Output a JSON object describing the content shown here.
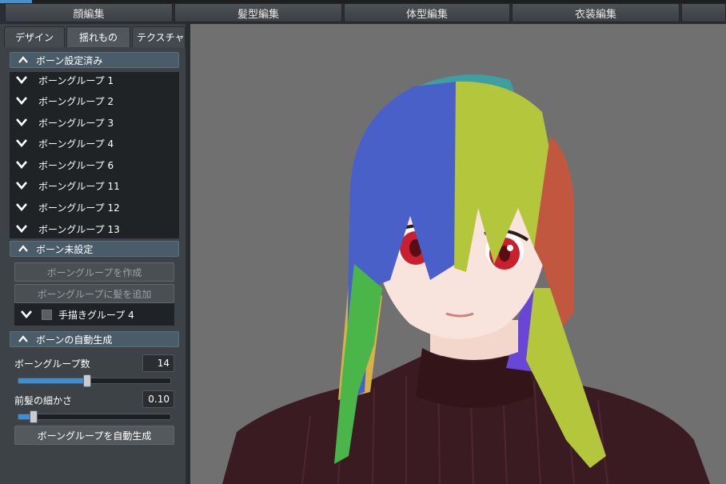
{
  "top_tabs": [
    "顔編集",
    "髪型編集",
    "体型編集",
    "衣装編集"
  ],
  "sub_tabs": [
    "デザイン",
    "揺れもの",
    "テクスチャ"
  ],
  "sections": {
    "bones_set": {
      "title": "ボーン設定済み",
      "groups": [
        "ボーングループ 1",
        "ボーングループ 2",
        "ボーングループ 3",
        "ボーングループ 4",
        "ボーングループ 6",
        "ボーングループ 11",
        "ボーングループ 12",
        "ボーングループ 13"
      ]
    },
    "bones_unset": {
      "title": "ボーン未設定",
      "create_button": "ボーングループを作成",
      "add_hair_button": "ボーングループに髪を追加",
      "hand_group": "手描きグループ 4"
    },
    "auto_gen": {
      "title": "ボーンの自動生成",
      "group_count_label": "ボーングループ数",
      "group_count_value": "14",
      "group_count_level": 0.45,
      "bangs_label": "前髪の細かさ",
      "bangs_value": "0.10",
      "bangs_level": 0.1,
      "generate_button": "ボーングループを自動生成"
    }
  },
  "colors": {
    "accent": "#3c8fd4",
    "panel": "#3d4246",
    "list_bg": "#1f2326",
    "header": "#4a5c6a"
  }
}
